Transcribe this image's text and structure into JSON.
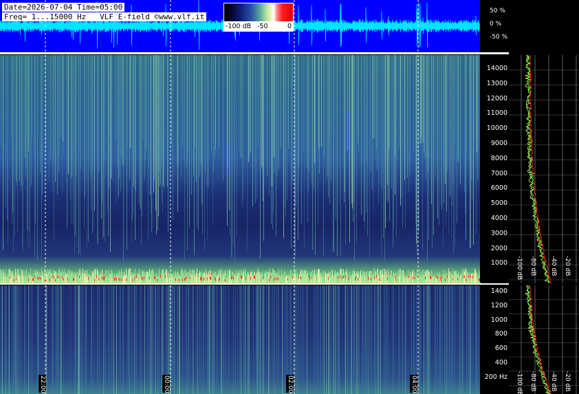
{
  "header": {
    "date_time": "Date=2026-07-04 Time=05:00",
    "freq_info": "Freq= 1...15000 Hz   VLF E-field ©www.vlf.it"
  },
  "colorbar": {
    "label_min": "-100 dB",
    "label_mid": "-50",
    "label_max": "0"
  },
  "waveform_scale": [
    "50 %",
    "0 %",
    "-50 %"
  ],
  "freq_axis_top": [
    "14000",
    "13000",
    "12000",
    "11000",
    "10000",
    "9000",
    "8000",
    "7000",
    "6000",
    "5000",
    "4000",
    "3000",
    "2000",
    "1000"
  ],
  "freq_axis_bottom": [
    "1400",
    "1200",
    "1000",
    "800",
    "600",
    "400",
    "200 Hz"
  ],
  "spectrum_db_labels": [
    "-100 dB",
    "-80 dB",
    "-40 dB",
    "-20 dB"
  ],
  "time_labels": [
    "22:00",
    "00:00",
    "02:00",
    "04:00"
  ],
  "colors": {
    "waveform_bg": "#0000ff",
    "waveform_trace": "#00e5ff",
    "spectrum_green": "#66ff33",
    "spectrum_red": "#ff2020",
    "spectrum_yellow": "#ffff66"
  }
}
